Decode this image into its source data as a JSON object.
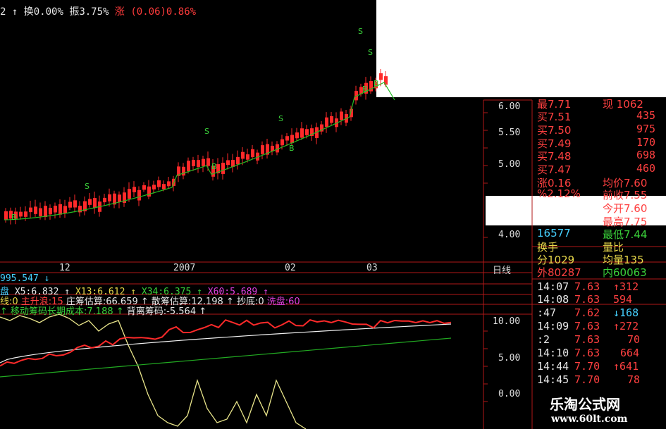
{
  "header": {
    "prefix": "2",
    "turnover": "↑ 换0.00%",
    "amplitude": "振3.75%",
    "change": "涨 (0.06)0.86%"
  },
  "price_axis": {
    "ticks": [
      "6.00",
      "5.50",
      "5.00",
      "4.00"
    ]
  },
  "time_axis": {
    "ticks": [
      "12",
      "2007",
      "02",
      "03",
      "日线"
    ]
  },
  "indicator_axis": {
    "ticks": [
      "10.00",
      "5.00",
      "0.00"
    ]
  },
  "indicators": {
    "row1": "995.547 ↓",
    "row2_prefix": "盘",
    "x5": "X5:6.832 ↑",
    "x13": "X13:6.612 ↑",
    "x34": "X34:6.375 ↑",
    "x60": "X60:5.689 ↑",
    "row3_a": "线:0",
    "row3_b": "主升浪:15",
    "row3_c": "庄筹估算:66.659 ↑",
    "row3_d": "散筹估算:12.198 ↑",
    "row3_e": "抄底:0",
    "row3_f": "洗盘:60",
    "row4_a": "↑ 移动筹码长期成本:7.188 ↑",
    "row4_b": "背离筹码:-5.564 ↑"
  },
  "quote_panel": {
    "top_left": "最7.71",
    "top_right": "现 1062",
    "bids": [
      {
        "label": "买7.51",
        "vol": "435"
      },
      {
        "label": "买7.50",
        "vol": "975"
      },
      {
        "label": "买7.49",
        "vol": "170"
      },
      {
        "label": "买7.48",
        "vol": "698"
      },
      {
        "label": "买7.47",
        "vol": "460"
      }
    ],
    "stats": [
      {
        "l": "涨0.16",
        "r": "均价7.60"
      },
      {
        "l": "%2.12%",
        "r": "前收7.55"
      },
      {
        "l": "",
        "r": "今开7.60"
      },
      {
        "l": "",
        "r": "最高7.75"
      },
      {
        "l": "16577",
        "r": "最低7.44"
      },
      {
        "l": "换手",
        "r": "量比"
      },
      {
        "l": "分1029",
        "r": "均量135"
      },
      {
        "l": "外80287",
        "r": "内60063"
      }
    ],
    "ticks": [
      {
        "time": "14:07",
        "price": "7.63",
        "vol": "↑312"
      },
      {
        "time": "14:08",
        "price": "7.63",
        "vol": "594"
      },
      {
        "time": ":47",
        "price": "7.62",
        "vol": "↓168"
      },
      {
        "time": "14:09",
        "price": "7.63",
        "vol": "↑272"
      },
      {
        "time": ":2",
        "price": "7.63",
        "vol": "70"
      },
      {
        "time": "14:10",
        "price": "7.63",
        "vol": "664"
      },
      {
        "time": "14:44",
        "price": "7.70",
        "vol": "↑641"
      },
      {
        "time": "14:45",
        "price": "7.70",
        "vol": "78"
      }
    ]
  },
  "watermark": {
    "name": "乐淘公式网",
    "url": "www.60lt.com"
  },
  "colors": {
    "up": "#ff2a2a",
    "ma": "#22bb22",
    "label": "#3ad13a"
  }
}
